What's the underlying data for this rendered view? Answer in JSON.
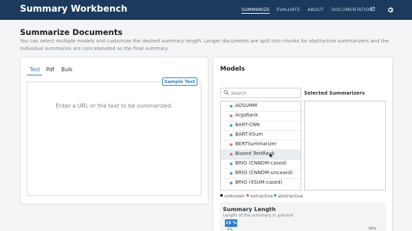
{
  "header": {
    "brand": "Summary Workbench",
    "nav": [
      {
        "label": "SUMMARIZE",
        "active": true
      },
      {
        "label": "EVALUATE",
        "active": false
      },
      {
        "label": "ABOUT",
        "active": false
      },
      {
        "label": "DOCUMENTATION",
        "active": false
      }
    ],
    "settings_icon": "gear-icon",
    "external_icon": "external-link-icon"
  },
  "page": {
    "title": "Summarize Documents",
    "description": "You can select multiple models and customize the desired summary length. Longer documents are split into chunks for abstractive summarizers and the individual summaries are concatenated as the final summary."
  },
  "input": {
    "tabs": [
      {
        "label": "Text",
        "active": true
      },
      {
        "label": "Pdf",
        "active": false
      },
      {
        "label": "Bulk",
        "active": false
      }
    ],
    "sample_button": "Sample Text",
    "placeholder": "Enter a URL or the text to be summarized."
  },
  "models": {
    "title": "Models",
    "search_placeholder": "Search",
    "selected_title": "Selected Summarizers",
    "list": [
      {
        "label": "AOSUMM",
        "kind": "abstractive"
      },
      {
        "label": "ArgsRank",
        "kind": "extractive"
      },
      {
        "label": "BART-CNN",
        "kind": "abstractive"
      },
      {
        "label": "BART-XSum",
        "kind": "abstractive"
      },
      {
        "label": "BERTSummarizer",
        "kind": "extractive"
      },
      {
        "label": "Biased TextRank",
        "kind": "extractive",
        "hover": true
      },
      {
        "label": "BRIO (CNNDM-cased)",
        "kind": "abstractive"
      },
      {
        "label": "BRIO (CNNDM-uncased)",
        "kind": "abstractive"
      },
      {
        "label": "BRIO (XSUM-cased)",
        "kind": "abstractive"
      }
    ],
    "legend": [
      {
        "label": "unknown",
        "color": "#222222"
      },
      {
        "label": "extractive",
        "color": "#e07b73"
      },
      {
        "label": "abstractive",
        "color": "#5b9bd5"
      }
    ]
  },
  "summary_length": {
    "title": "Summary Length",
    "description": "Length of the summary in percent",
    "value_label": "15 %",
    "value_percent": 15,
    "tick_left": "1%",
    "tick_right": "50%"
  },
  "colors": {
    "header_bg": "#1b3a5e",
    "accent": "#2a7cc7",
    "extractive": "#e07b73",
    "abstractive": "#5b9bd5"
  }
}
